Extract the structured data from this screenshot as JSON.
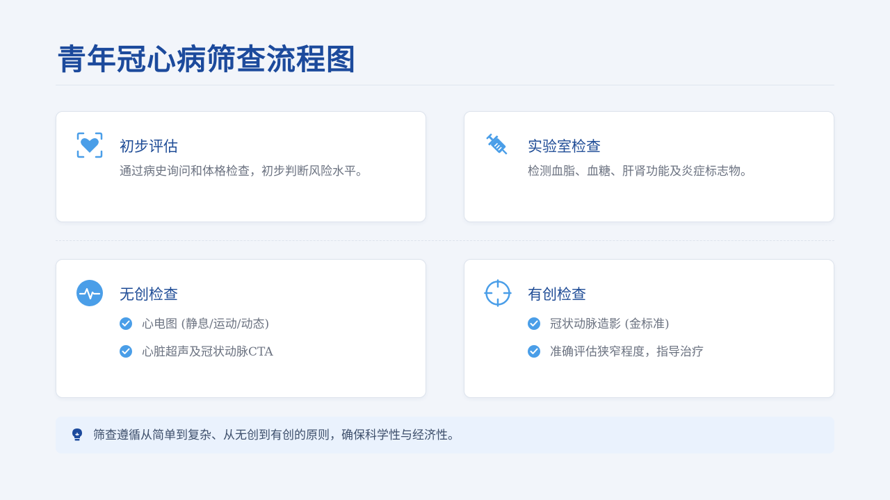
{
  "page": {
    "title": "青年冠心病筛查流程图"
  },
  "cards": {
    "initial": {
      "icon": "heart-scan-icon",
      "title": "初步评估",
      "desc": "通过病史询问和体格检查，初步判断风险水平。"
    },
    "lab": {
      "icon": "syringe-icon",
      "title": "实验室检查",
      "desc": "检测血脂、血糖、肝肾功能及炎症标志物。"
    },
    "noninvasive": {
      "icon": "heartbeat-icon",
      "title": "无创检查",
      "items": [
        "心电图 (静息/运动/动态)",
        "心脏超声及冠状动脉CTA"
      ]
    },
    "invasive": {
      "icon": "crosshairs-icon",
      "title": "有创检查",
      "items": [
        "冠状动脉造影 (金标准)",
        "准确评估狭窄程度，指导治疗"
      ]
    }
  },
  "note": {
    "icon": "lightbulb-icon",
    "text": "筛查遵循从简单到复杂、从无创到有创的原则，确保科学性与经济性。"
  },
  "colors": {
    "title": "#1c4a9c",
    "accent": "#4a9ee8",
    "background": "#f2f5fa",
    "note_bg": "#eaf2fd"
  }
}
